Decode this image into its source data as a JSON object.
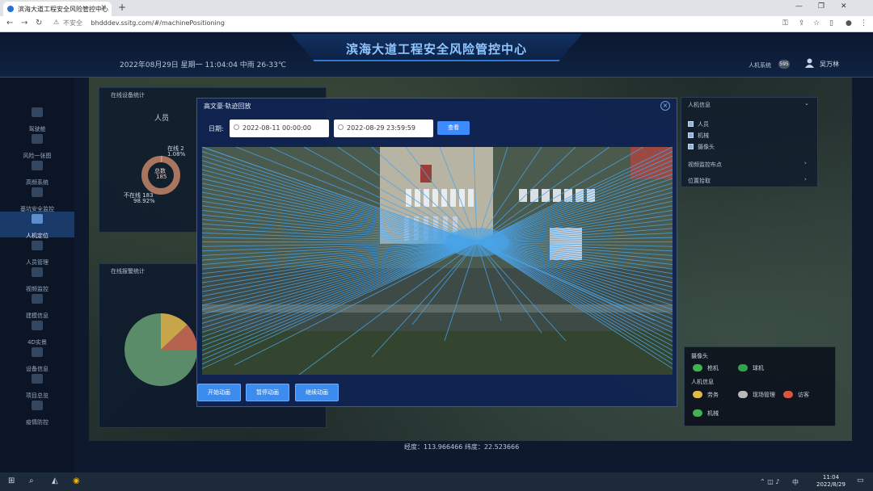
{
  "browser": {
    "tab_title": "滨海大道工程安全风险管控中心",
    "new_tab": "+",
    "security_label": "不安全",
    "url": "bhdddev.ssitg.com/#/machinePositioning"
  },
  "header": {
    "title": "滨海大道工程安全风险管控中心",
    "datetime": "2022年08月29日 星期一   11:04:04  中雨 26-33℃",
    "system_name": "人机系统",
    "system_badge": "595",
    "user_name": "吴万林"
  },
  "nav": {
    "items": [
      {
        "label": "驾驶舱",
        "active": false
      },
      {
        "label": "风险一张图",
        "active": false
      },
      {
        "label": "高频系统",
        "active": false
      },
      {
        "label": "基坑安全监控",
        "active": false
      },
      {
        "label": "人机定位",
        "active": true
      },
      {
        "label": "人员管理",
        "active": false
      },
      {
        "label": "视频监控",
        "active": false
      },
      {
        "label": "建模信息",
        "active": false
      },
      {
        "label": "4D实景",
        "active": false
      },
      {
        "label": "设备信息",
        "active": false
      },
      {
        "label": "项目总览",
        "active": false
      },
      {
        "label": "疫情防控",
        "active": false
      }
    ]
  },
  "left_panel": {
    "online_title": "在线设备统计",
    "persons_label": "人员",
    "donut_center_label": "总数",
    "donut_center_value": "185",
    "online_label": "在线 2",
    "online_pct": "1.08%",
    "offline_label": "不在线 183",
    "offline_pct": "98.92%",
    "alarm_title": "在线报警统计",
    "donut_colors": {
      "online": "#ee9a6c",
      "offline": "#a9755e"
    },
    "pie_slices": [
      {
        "value": 75,
        "color": "#5b8c6a"
      },
      {
        "value": 13,
        "color": "#c9a54a"
      },
      {
        "value": 12,
        "color": "#b5624f"
      }
    ]
  },
  "right_panel": {
    "header": "人机信息",
    "options": [
      {
        "label": "人员",
        "checked": true
      },
      {
        "label": "机械",
        "checked": true
      },
      {
        "label": "摄像头",
        "checked": true
      }
    ],
    "video_label": "视频监控布点",
    "location_label": "位置拾取"
  },
  "legend": {
    "camera_title": "摄像头",
    "gun_camera": "枪机",
    "dome_camera": "球机",
    "persons_title": "人机信息",
    "labor": "劳务",
    "site_manager": "现场管理",
    "visitor": "访客",
    "machinery": "机械",
    "colors": {
      "gun": "#3fb34f",
      "dome": "#2fa44a",
      "labor": "#e0b84a",
      "manager": "#b9b9b9",
      "visitor": "#d9553f",
      "machinery": "#3fb34f"
    }
  },
  "coords": "经度：113.966466     纬度：22.523666",
  "modal": {
    "title": "高文豪·轨迹回放",
    "close": "×",
    "date_label": "日期:",
    "start_date": "2022-08-11 00:00:00",
    "end_date": "2022-08-29 23:59:59",
    "query_button": "查看",
    "start_button": "开始动画",
    "pause_button": "暂停动画",
    "resume_button": "继续动画",
    "track_color": "#4aa3e8"
  },
  "taskbar": {
    "time": "11:04",
    "date": "2022/8/29",
    "lang": "中"
  }
}
